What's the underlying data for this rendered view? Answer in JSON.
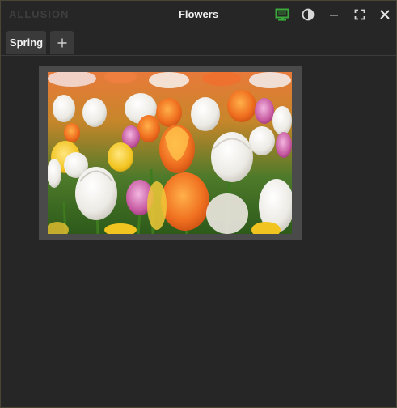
{
  "app": {
    "logo_text": "ALLUSION",
    "title": "Flowers"
  },
  "titlebar": {
    "buttons": [
      {
        "name": "monitor-icon",
        "color": "#3aa83a"
      },
      {
        "name": "contrast-icon",
        "color": "#d8d8d8"
      },
      {
        "name": "minimize-icon",
        "color": "#b8b8b8"
      },
      {
        "name": "fullscreen-icon",
        "color": "#d8d8d8"
      },
      {
        "name": "close-icon",
        "color": "#e8e8e8"
      }
    ]
  },
  "tabs": [
    {
      "label": "Spring",
      "active": true
    }
  ],
  "tab_add_label": "+",
  "canvas": {
    "image_subject": "tulips"
  },
  "colors": {
    "background": "#262626",
    "frame": "#4a4a4a",
    "accent_green": "#3aa83a"
  }
}
